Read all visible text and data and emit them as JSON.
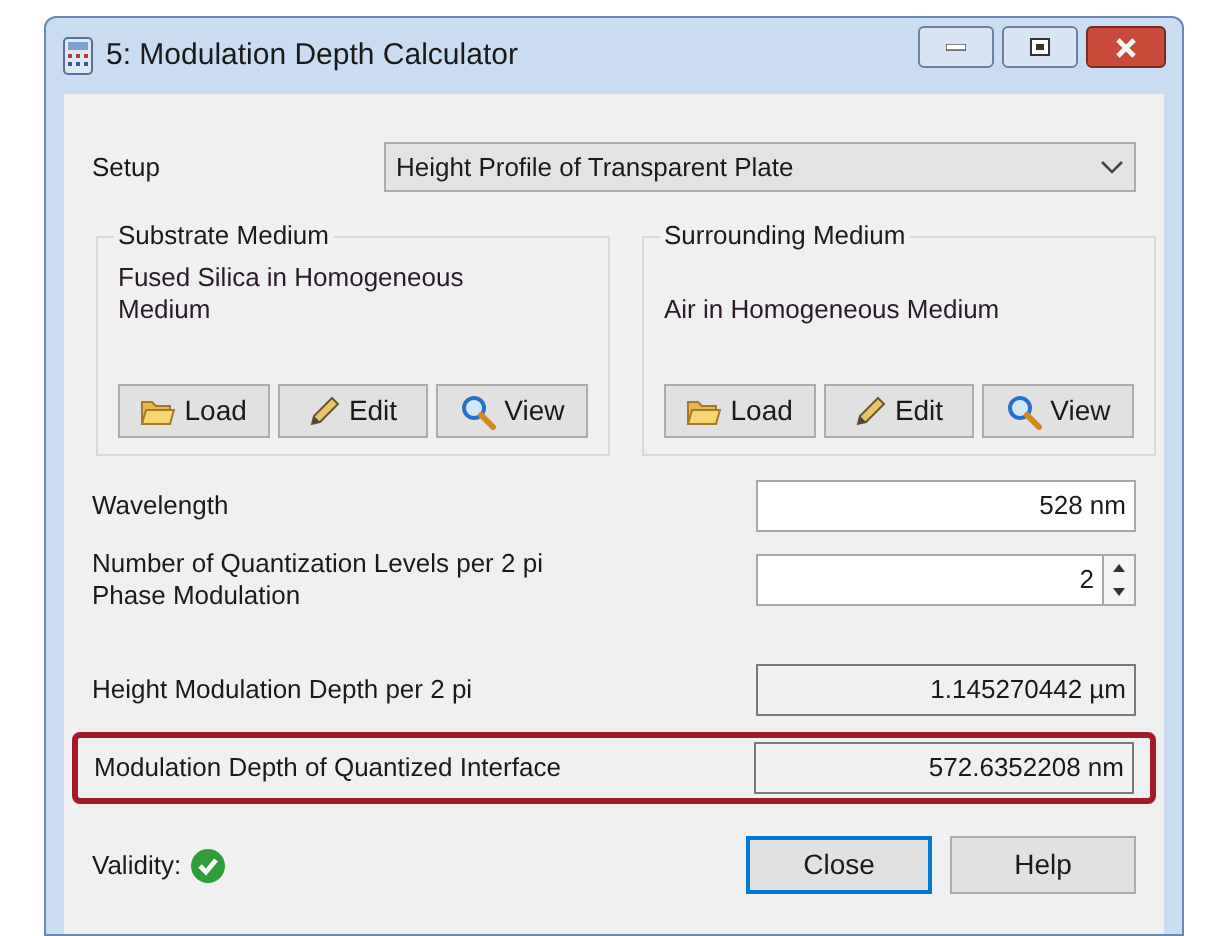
{
  "window": {
    "title": "5: Modulation Depth Calculator"
  },
  "setup": {
    "label": "Setup",
    "value": "Height Profile of Transparent Plate"
  },
  "groups": [
    {
      "title": "Substrate Medium",
      "medium": "Fused Silica in Homogeneous Medium",
      "buttons": [
        {
          "kind": "load",
          "label": "Load"
        },
        {
          "kind": "edit",
          "label": "Edit"
        },
        {
          "kind": "view",
          "label": "View"
        }
      ]
    },
    {
      "title": "Surrounding Medium",
      "medium": "Air in Homogeneous Medium",
      "buttons": [
        {
          "kind": "load",
          "label": "Load"
        },
        {
          "kind": "edit",
          "label": "Edit"
        },
        {
          "kind": "view",
          "label": "View"
        }
      ]
    }
  ],
  "fields": [
    {
      "kind": "input",
      "label": "Wavelength",
      "value": "528 nm",
      "highlighted": false
    },
    {
      "kind": "spinner",
      "label": "Number of Quantization Levels per 2 pi Phase Modulation",
      "value": "2",
      "highlighted": false
    },
    {
      "kind": "readonly",
      "label": "Height Modulation Depth per 2 pi",
      "value": "1.145270442 µm",
      "highlighted": false
    },
    {
      "kind": "readonly",
      "label": "Modulation Depth of Quantized Interface",
      "value": "572.6352208 nm",
      "highlighted": true
    }
  ],
  "validity": {
    "label": "Validity:",
    "valid": true
  },
  "buttons": [
    {
      "label": "Close",
      "default": true
    },
    {
      "label": "Help",
      "default": false
    }
  ]
}
